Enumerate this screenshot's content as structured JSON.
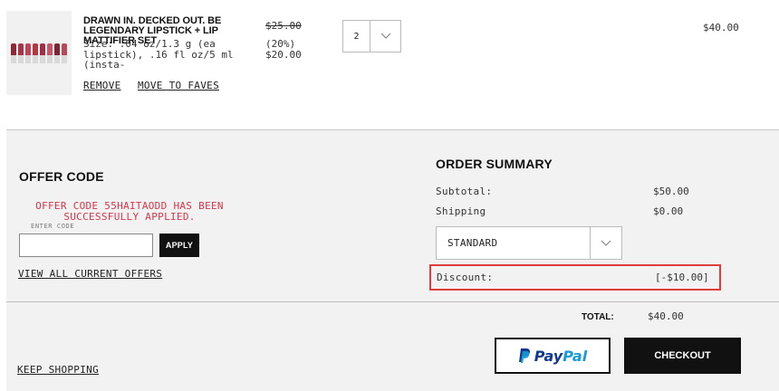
{
  "product": {
    "title": "DRAWN IN. DECKED OUT. BE LEGENDARY LIPSTICK + LIP MATTIFIER SET",
    "size": "Size: .04 oz/1.3 g (ea lipstick), .16 fl oz/5 ml (insta-",
    "remove_label": "REMOVE",
    "faves_label": "MOVE TO FAVES",
    "original_price": "$25.00",
    "discount_pct": "(20%)",
    "sale_price": "$20.00",
    "quantity": "2",
    "line_total": "$40.00"
  },
  "offer": {
    "heading": "OFFER CODE",
    "success_message": "OFFER CODE 55HAITAODD HAS BEEN SUCCESSFULLY APPLIED.",
    "input_label": "ENTER CODE",
    "input_value": "",
    "apply_label": "APPLY",
    "view_offers_label": "VIEW ALL CURRENT OFFERS"
  },
  "summary": {
    "heading": "ORDER SUMMARY",
    "subtotal_label": "Subtotal:",
    "subtotal_value": "$50.00",
    "shipping_label": "Shipping",
    "shipping_value": "$0.00",
    "shipping_method": "STANDARD",
    "discount_label": "Discount:",
    "discount_value": "[-$10.00]",
    "total_label": "TOTAL:",
    "total_value": "$40.00"
  },
  "actions": {
    "paypal_a": "Pay",
    "paypal_b": "Pal",
    "checkout_label": "CHECKOUT",
    "keep_shopping_label": "KEEP SHOPPING"
  },
  "colors": {
    "success_text": "#d9354a",
    "highlight_border": "#e23b3b",
    "paypal_dark": "#123a8c",
    "paypal_light": "#179bd7",
    "lipsticks": [
      "#8c2a3a",
      "#a8344a",
      "#c0455c",
      "#b23a3f",
      "#9e2f47",
      "#c8566a",
      "#7d2534",
      "#b44a55"
    ]
  }
}
